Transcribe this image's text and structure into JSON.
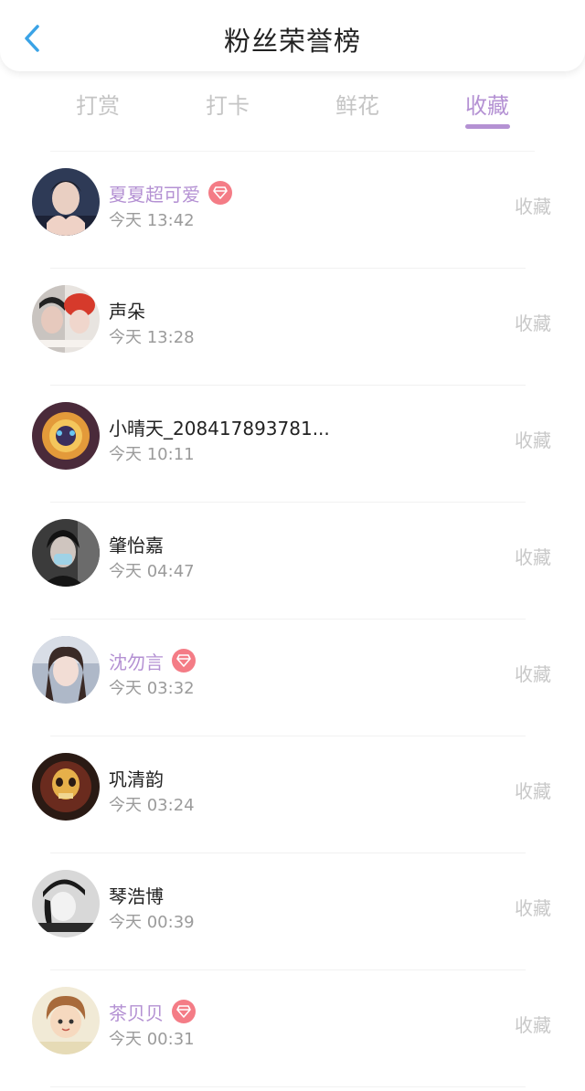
{
  "header": {
    "title": "粉丝荣誉榜"
  },
  "tabs": [
    {
      "label": "打赏",
      "active": false
    },
    {
      "label": "打卡",
      "active": false
    },
    {
      "label": "鲜花",
      "active": false
    },
    {
      "label": "收藏",
      "active": true
    }
  ],
  "colors": {
    "accent": "#b491d3",
    "vip_badge": "#f47c86",
    "back_arrow": "#3aa3e6"
  },
  "fans": [
    {
      "name": "夏夏超可爱",
      "time": "今天 13:42",
      "action": "收藏",
      "vip": true
    },
    {
      "name": "声朵",
      "time": "今天 13:28",
      "action": "收藏",
      "vip": false
    },
    {
      "name": "小晴天_208417893781...",
      "time": "今天 10:11",
      "action": "收藏",
      "vip": false
    },
    {
      "name": "肇怡嘉",
      "time": "今天 04:47",
      "action": "收藏",
      "vip": false
    },
    {
      "name": "沈勿言",
      "time": "今天 03:32",
      "action": "收藏",
      "vip": true
    },
    {
      "name": "巩清韵",
      "time": "今天 03:24",
      "action": "收藏",
      "vip": false
    },
    {
      "name": "琴浩博",
      "time": "今天 00:39",
      "action": "收藏",
      "vip": false
    },
    {
      "name": "茶贝贝",
      "time": "今天 00:31",
      "action": "收藏",
      "vip": true
    }
  ]
}
